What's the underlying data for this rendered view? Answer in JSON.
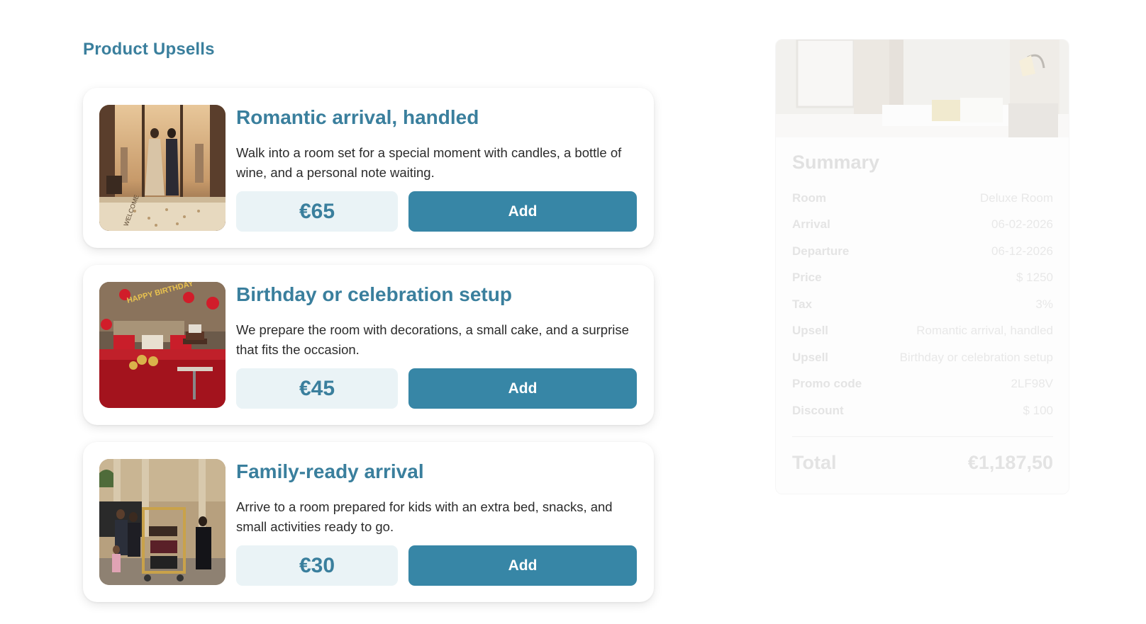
{
  "page": {
    "section_title": "Product Upsells"
  },
  "upsells": [
    {
      "title": "Romantic arrival, handled",
      "description": "Walk into a room set for a special moment with candles, a bottle of wine, and a personal note waiting.",
      "price": "€65",
      "add_label": "Add",
      "image_text": "WELCOME"
    },
    {
      "title": "Birthday or celebration setup",
      "description": "We prepare the room with decorations, a small cake, and a surprise that fits the occasion.",
      "price": "€45",
      "add_label": "Add",
      "image_text": "HAPPY BIRTHDAY"
    },
    {
      "title": "Family-ready arrival",
      "description": "Arrive to a room prepared for kids with an extra bed, snacks, and small activities ready to go.",
      "price": "€30",
      "add_label": "Add"
    }
  ],
  "summary": {
    "title": "Summary",
    "rows": [
      {
        "label": "Room",
        "value": "Deluxe Room"
      },
      {
        "label": "Arrival",
        "value": "06-02-2026"
      },
      {
        "label": "Departure",
        "value": "06-12-2026"
      },
      {
        "label": "Price",
        "value": "$ 1250"
      },
      {
        "label": "Tax",
        "value": "3%"
      },
      {
        "label": "Upsell",
        "value": "Romantic arrival, handled"
      },
      {
        "label": "Upsell",
        "value": "Birthday or celebration setup"
      },
      {
        "label": "Promo code",
        "value": "2LF98V"
      },
      {
        "label": "Discount",
        "value": "$ 100"
      }
    ],
    "total_label": "Total",
    "total_value": "€1,187,50"
  },
  "colors": {
    "accent": "#3a7f9d",
    "button": "#3786a6",
    "price_bg": "#eaf3f6"
  }
}
